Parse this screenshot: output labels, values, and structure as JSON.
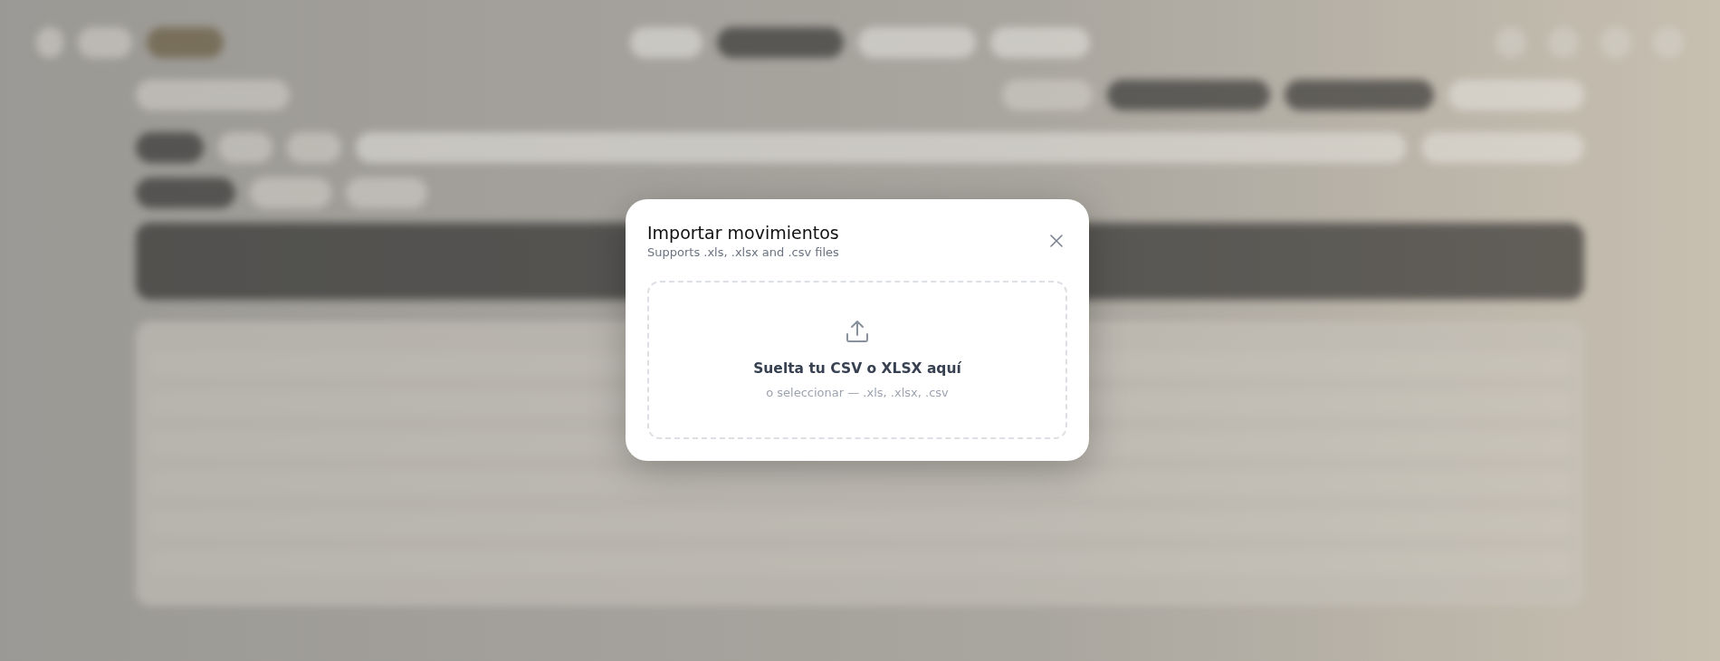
{
  "modal": {
    "title": "Importar movimientos",
    "subtitle": "Supports .xls, .xlsx and .csv files",
    "dropzone": {
      "title": "Suelta tu CSV o XLSX aquí",
      "hint": "o seleccionar — .xls, .xlsx, .csv"
    }
  }
}
